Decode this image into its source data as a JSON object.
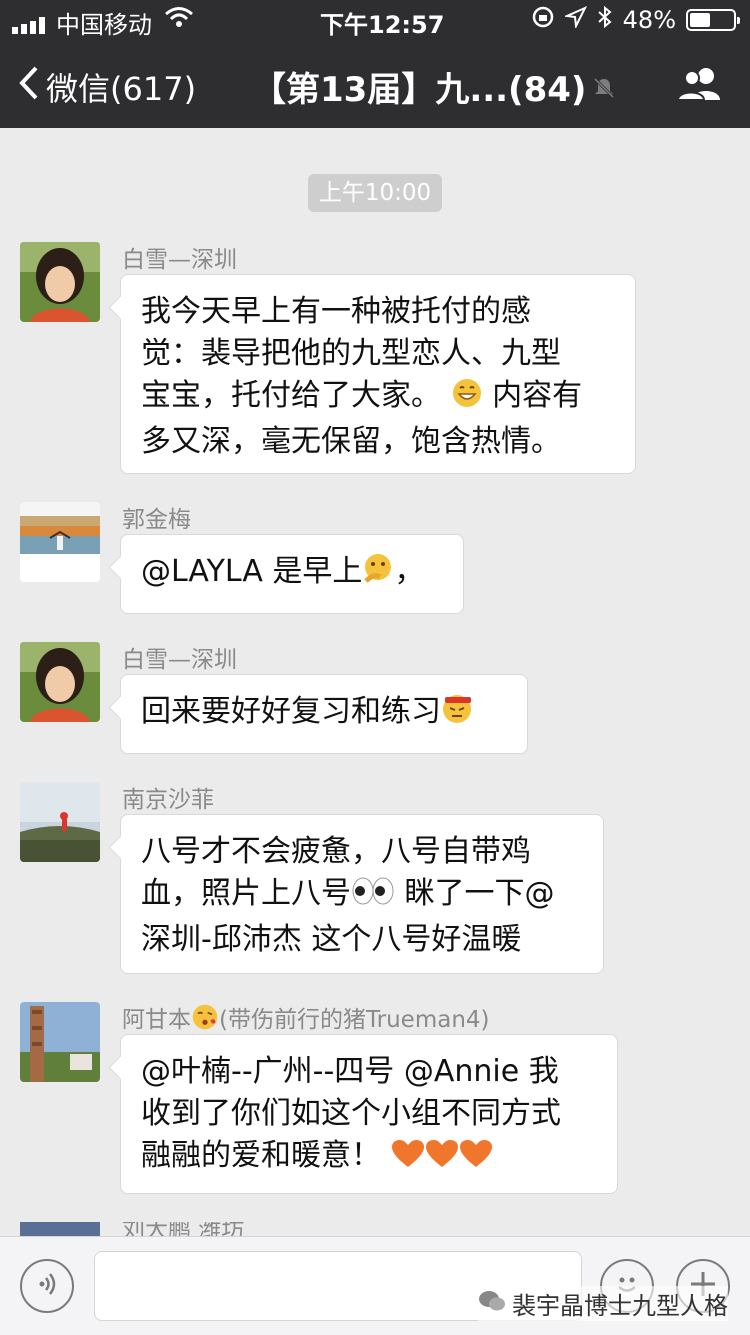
{
  "status_bar": {
    "carrier": "中国移动",
    "time": "下午12:57",
    "battery_text": "48%",
    "battery_level": 0.48
  },
  "nav": {
    "back_label": "微信(617)",
    "title": "【第13届】九...(84)"
  },
  "chat": {
    "timestamp": "上午10:00",
    "messages": [
      {
        "sender": "白雪—深圳",
        "lines": [
          "我今天早上有一种被托付的感",
          "觉：裴导把他的九型恋人、九型",
          "宝宝，托付给了大家。",
          "内容有",
          "多又深，毫无保留，饱含热情。"
        ]
      },
      {
        "sender": "郭金梅",
        "lines": [
          "@LAYLA 是早上",
          "，"
        ]
      },
      {
        "sender": "白雪—深圳",
        "lines": [
          "回来要好好复习和练习"
        ]
      },
      {
        "sender": "南京沙菲",
        "lines": [
          "八号才不会疲惫，八号自带鸡",
          "血，照片上八号",
          " 眯了一下@",
          "深圳-邱沛杰 这个八号好温暖"
        ]
      },
      {
        "sender_parts": [
          "阿甘本",
          "(带伤前行的猪Trueman4)"
        ],
        "lines": [
          "@叶楠--广州--四号 @Annie 我",
          "收到了你们如这个小组不同方式",
          "融融的爱和暖意！"
        ]
      },
      {
        "sender": "刘大鹏 潍坊"
      }
    ]
  },
  "input_bar": {
    "watermark": "裴宇晶博士九型人格"
  },
  "colors": {
    "nav_bg": "#2e2e30",
    "chat_bg": "#ebebeb",
    "bubble_bg": "#ffffff"
  },
  "icons": [
    "signal-icon",
    "wifi-icon",
    "lock-rotation-icon",
    "location-icon",
    "bluetooth-icon",
    "battery-icon",
    "back-chevron-icon",
    "mute-icon",
    "group-members-icon",
    "voice-icon",
    "emoji-icon",
    "plus-icon",
    "wechat-icon"
  ]
}
